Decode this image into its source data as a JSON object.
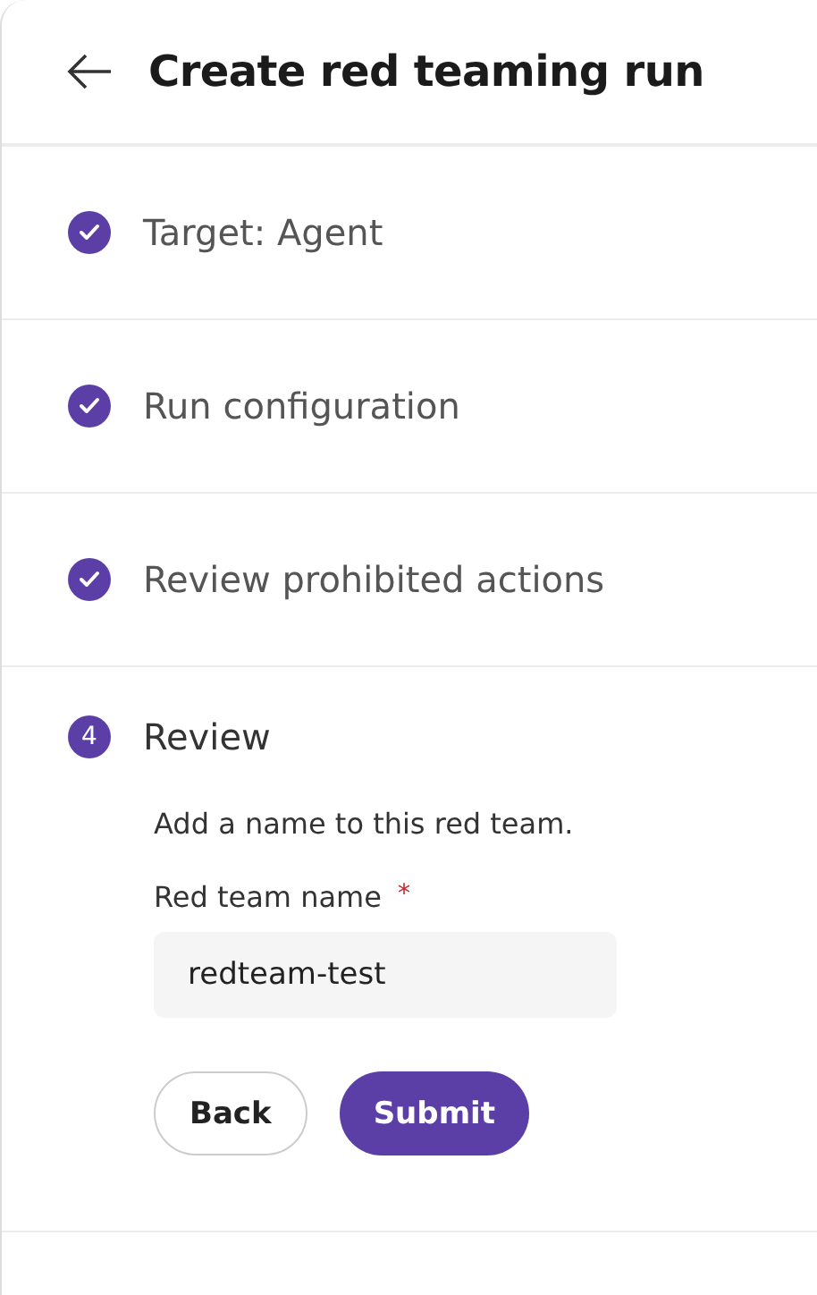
{
  "header": {
    "title": "Create red teaming run"
  },
  "steps": [
    {
      "label": "Target: Agent",
      "completed": true
    },
    {
      "label": "Run configuration",
      "completed": true
    },
    {
      "label": "Review prohibited actions",
      "completed": true
    },
    {
      "label": "Review",
      "completed": false,
      "number": "4"
    }
  ],
  "review": {
    "description": "Add a name to this red team.",
    "field": {
      "label": "Red team name",
      "required_mark": "*",
      "value": "redteam-test"
    },
    "buttons": [
      {
        "label": "Back",
        "kind": "secondary"
      },
      {
        "label": "Submit",
        "kind": "primary"
      }
    ]
  }
}
